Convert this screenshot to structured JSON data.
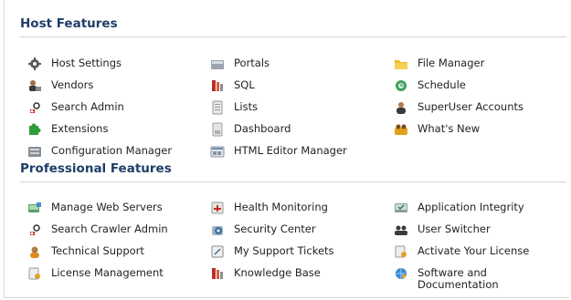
{
  "host_features": {
    "title": "Host Features",
    "col1": [
      {
        "label": "Host Settings",
        "icon": "gear-icon"
      },
      {
        "label": "Vendors",
        "icon": "vendors-icon"
      },
      {
        "label": "Search Admin",
        "icon": "search-admin-icon"
      },
      {
        "label": "Extensions",
        "icon": "puzzle-icon"
      },
      {
        "label": "Configuration Manager",
        "icon": "config-icon"
      }
    ],
    "col2": [
      {
        "label": "Portals",
        "icon": "portals-icon"
      },
      {
        "label": "SQL",
        "icon": "sql-icon"
      },
      {
        "label": "Lists",
        "icon": "lists-icon"
      },
      {
        "label": "Dashboard",
        "icon": "dashboard-icon"
      },
      {
        "label": "HTML Editor Manager",
        "icon": "html-editor-icon"
      }
    ],
    "col3": [
      {
        "label": "File Manager",
        "icon": "folder-icon"
      },
      {
        "label": "Schedule",
        "icon": "schedule-icon"
      },
      {
        "label": "SuperUser Accounts",
        "icon": "superuser-icon"
      },
      {
        "label": "What's New",
        "icon": "whats-new-icon"
      }
    ]
  },
  "professional_features": {
    "title": "Professional Features",
    "col1": [
      {
        "label": "Manage Web Servers",
        "icon": "web-servers-icon"
      },
      {
        "label": "Search Crawler Admin",
        "icon": "search-crawler-icon"
      },
      {
        "label": "Technical Support",
        "icon": "support-icon"
      },
      {
        "label": "License Management",
        "icon": "license-icon"
      }
    ],
    "col2": [
      {
        "label": "Health Monitoring",
        "icon": "health-icon"
      },
      {
        "label": "Security Center",
        "icon": "security-icon"
      },
      {
        "label": "My Support Tickets",
        "icon": "tickets-icon"
      },
      {
        "label": "Knowledge Base",
        "icon": "knowledge-icon"
      }
    ],
    "col3": [
      {
        "label": "Application Integrity",
        "icon": "integrity-icon"
      },
      {
        "label": "User Switcher",
        "icon": "user-switcher-icon"
      },
      {
        "label": "Activate Your License",
        "icon": "activate-license-icon"
      },
      {
        "label": "Software and Documentation",
        "icon": "software-docs-icon"
      }
    ]
  },
  "colors": {
    "heading": "#1e3e66",
    "divider": "#d4d4d4",
    "text": "#222222"
  }
}
